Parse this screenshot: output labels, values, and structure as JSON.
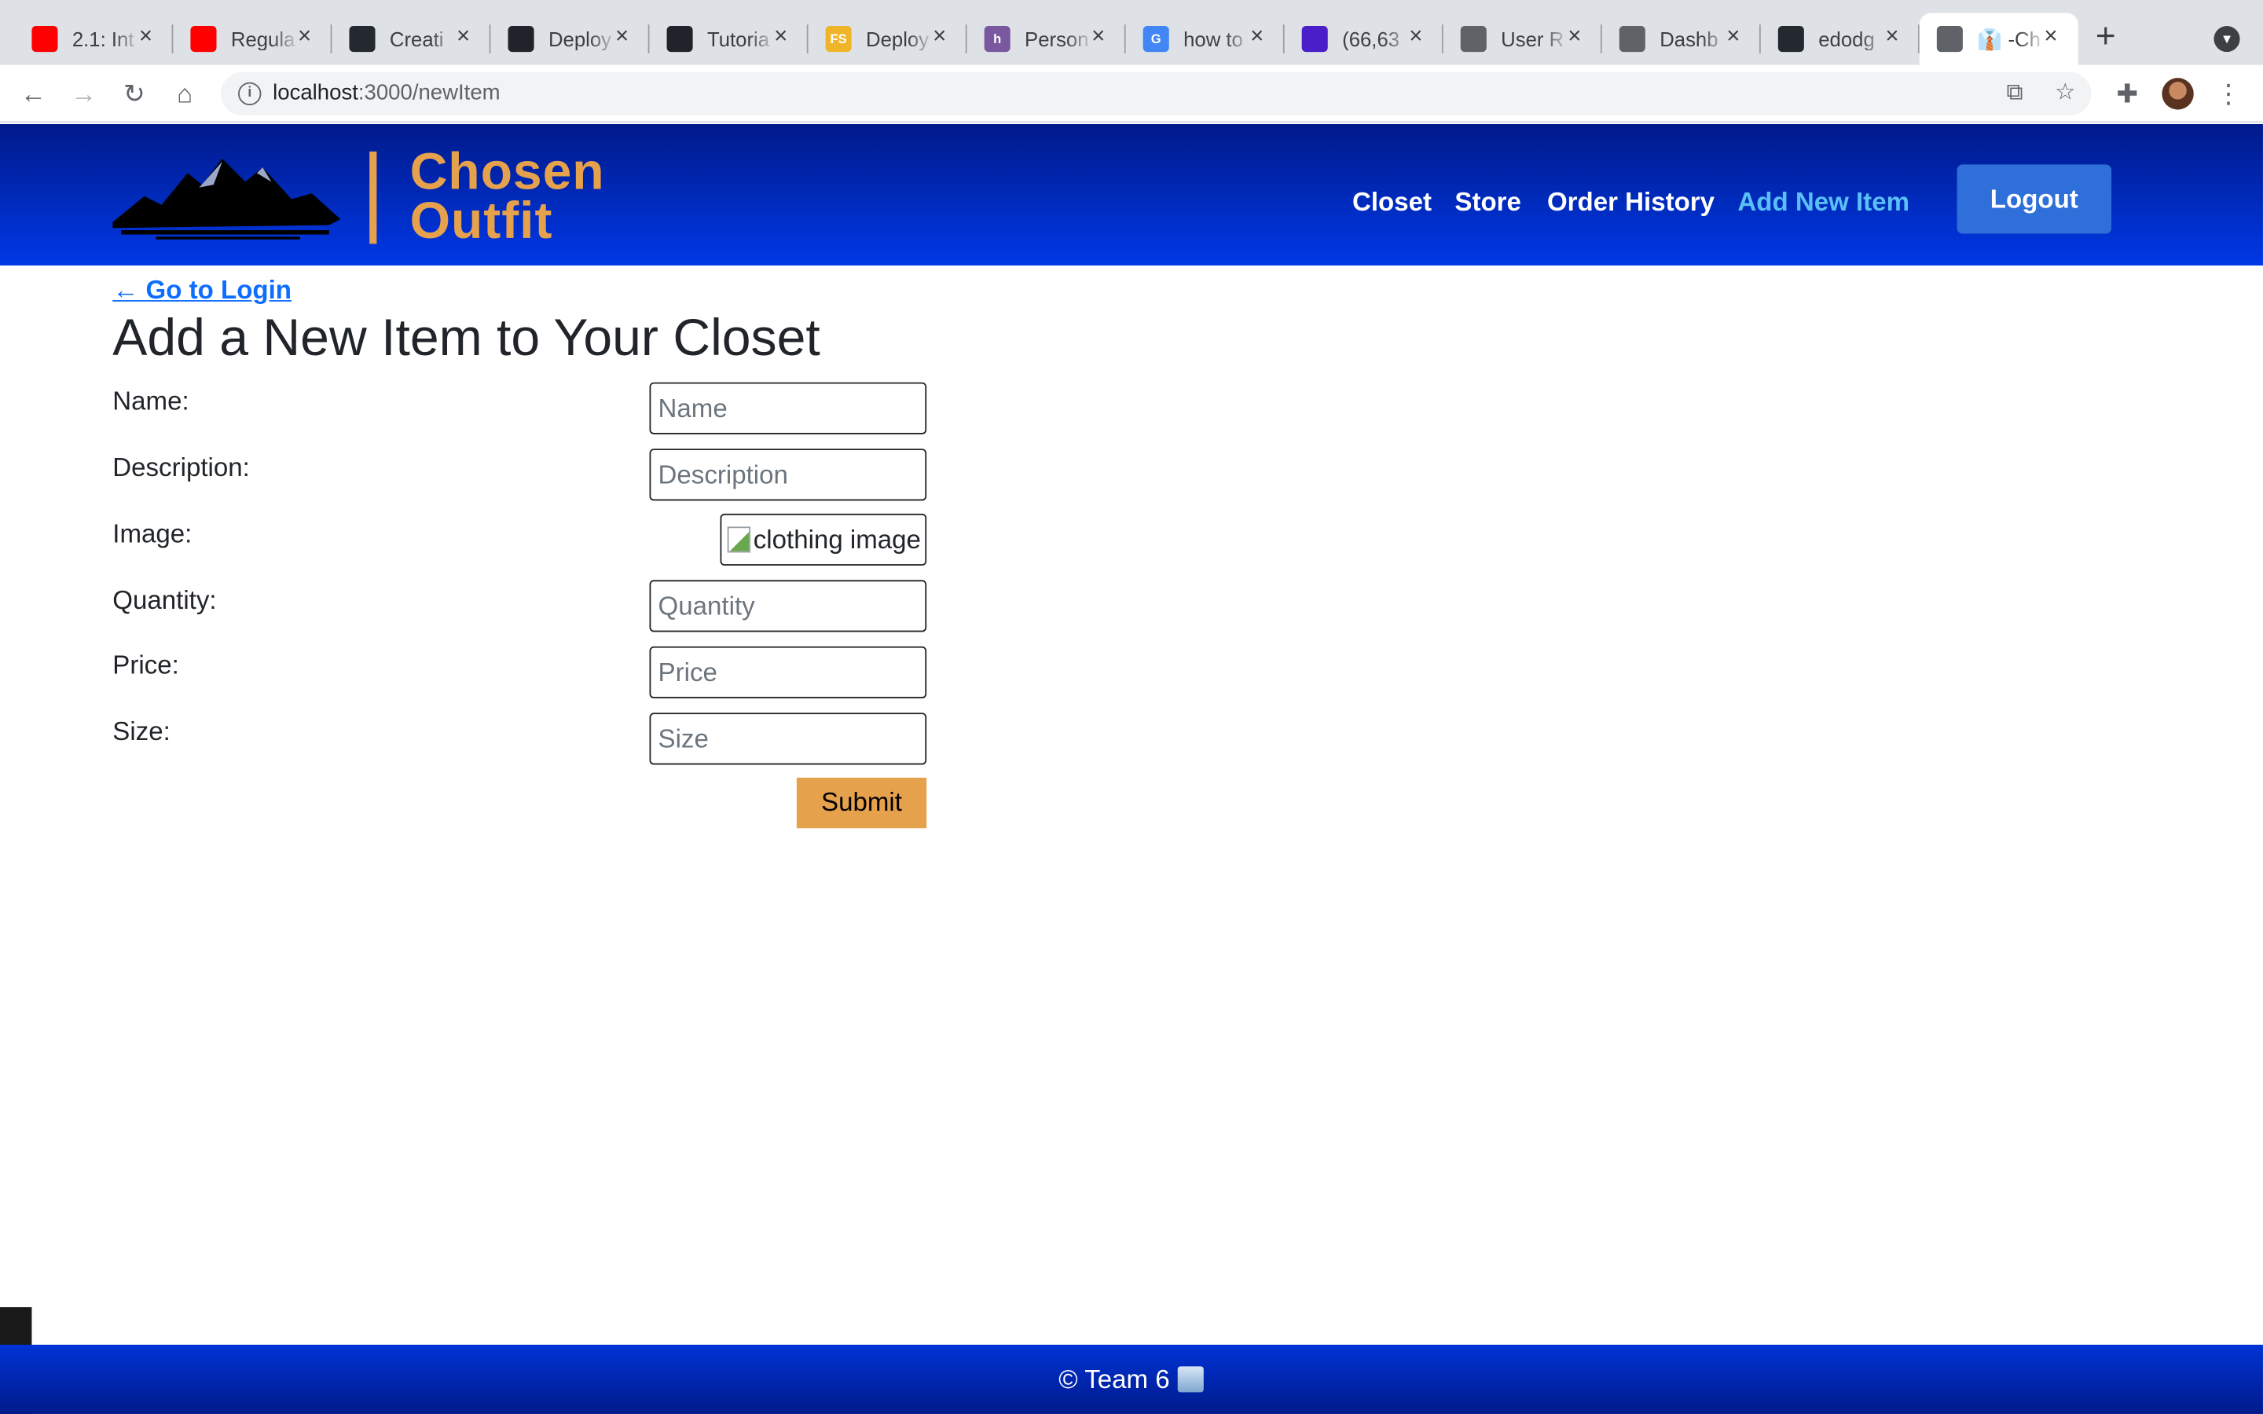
{
  "browser": {
    "tabs": [
      {
        "icon": "youtube-icon",
        "title": "2.1: Int",
        "color": "#ff0000"
      },
      {
        "icon": "youtube-icon",
        "title": "Regula",
        "color": "#ff0000"
      },
      {
        "icon": "github-icon",
        "title": "Creati",
        "color": "#24292f"
      },
      {
        "icon": "react-icon",
        "title": "Deploy",
        "color": "#20232a"
      },
      {
        "icon": "react-icon",
        "title": "Tutoria",
        "color": "#20232a"
      },
      {
        "icon": "fs-icon",
        "title": "Deploy",
        "color": "#f0b429",
        "label": "FS"
      },
      {
        "icon": "heroku-icon",
        "title": "Person",
        "color": "#79589f",
        "label": "h"
      },
      {
        "icon": "google-icon",
        "title": "how to",
        "color": "#4285f4",
        "label": "G"
      },
      {
        "icon": "mail-icon",
        "title": "(66,63",
        "color": "#4a1fc9"
      },
      {
        "icon": "globe-icon",
        "title": "User R",
        "color": "#5f6368"
      },
      {
        "icon": "globe-icon",
        "title": "Dashb",
        "color": "#5f6368"
      },
      {
        "icon": "github-icon",
        "title": "edodg",
        "color": "#24292f"
      },
      {
        "icon": "globe-icon",
        "title": "👔 -Ch",
        "color": "#5f6368",
        "active": true
      }
    ],
    "url_host": "localhost",
    "url_path": ":3000/newItem"
  },
  "header": {
    "brand_line1": "Chosen",
    "brand_line2": "Outfit",
    "nav": [
      "Closet",
      "Store",
      "Order History",
      "Add New Item"
    ],
    "logout_label": "Logout",
    "colors": {
      "brand": "#e6a14d",
      "header_bg": "#0038e6",
      "active_nav": "#5bc0f5"
    }
  },
  "main": {
    "back_link": "← Go to Login",
    "title": "Add a New Item to Your Closet",
    "fields": {
      "name": {
        "label": "Name:",
        "placeholder": "Name"
      },
      "description": {
        "label": "Description:",
        "placeholder": "Description"
      },
      "image": {
        "label": "Image:",
        "alt": "clothing image"
      },
      "quantity": {
        "label": "Quantity:",
        "placeholder": "Quantity"
      },
      "price": {
        "label": "Price:",
        "placeholder": "Price"
      },
      "size": {
        "label": "Size:",
        "placeholder": "Size"
      }
    },
    "submit_label": "Submit"
  },
  "footer": {
    "text": "© Team 6"
  }
}
